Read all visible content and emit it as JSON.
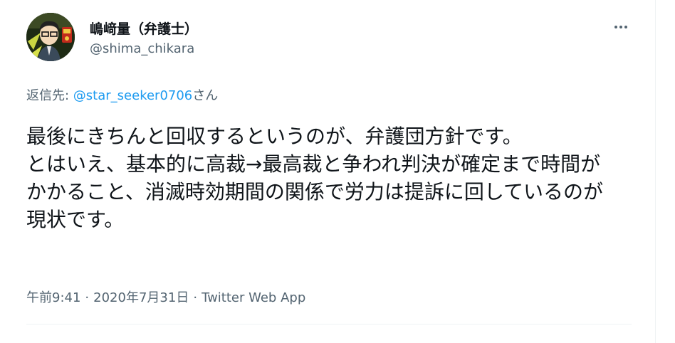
{
  "author": {
    "display_name": "嶋﨑量（弁護士）",
    "handle": "@shima_chikara",
    "avatar_icon": "avatar-illustration"
  },
  "reply": {
    "prefix": "返信先: ",
    "mention": "@star_seeker0706",
    "suffix": "さん"
  },
  "tweet": {
    "text": "最後にきちんと回収するというのが、弁護団方針です。\nとはいえ、基本的に高裁→最高裁と争われ判決が確定まで時間がかかること、消滅時効期間の関係で労力は提訴に回しているのが現状です。"
  },
  "meta": {
    "time": "午前9:41",
    "separator": "·",
    "date": "2020年7月31日",
    "source": "Twitter Web App"
  },
  "colors": {
    "text": "#0f1419",
    "secondary": "#536471",
    "link": "#1d9bf0",
    "divider": "#eff3f4"
  },
  "icons": {
    "more": "more-horizontal-icon"
  }
}
